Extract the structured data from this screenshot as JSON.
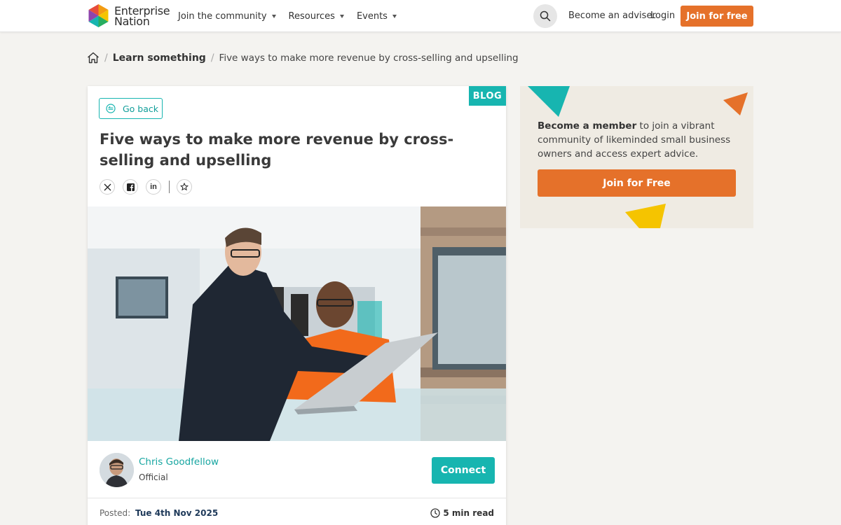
{
  "header": {
    "logo_line1": "Enterprise",
    "logo_line2": "Nation",
    "nav": [
      {
        "label": "Join the community"
      },
      {
        "label": "Resources"
      },
      {
        "label": "Events"
      }
    ],
    "become_adviser": "Become an adviser",
    "login": "Login",
    "join_label": "Join for free"
  },
  "breadcrumb": {
    "section": "Learn something",
    "current": "Five ways to make more revenue by cross-selling and upselling"
  },
  "article": {
    "tag": "BLOG",
    "go_back": "Go back",
    "title": "Five ways to make more revenue by cross-selling and upselling",
    "share_icons": [
      "x-icon",
      "facebook-icon",
      "linkedin-icon",
      "star-icon"
    ],
    "linkedin_glyph": "in",
    "author": {
      "name": "Chris Goodfellow",
      "role": "Official"
    },
    "connect_label": "Connect",
    "posted_label": "Posted:",
    "posted_date": "Tue 4th Nov 2025",
    "read_time": "5 min read"
  },
  "sidebar": {
    "bold": "Become a member",
    "text": " to join a vibrant community of likeminded small business owners and access expert advice.",
    "button": "Join for Free"
  },
  "colors": {
    "teal": "#17b5b0",
    "orange": "#e5712a",
    "yellow": "#f5c400"
  }
}
